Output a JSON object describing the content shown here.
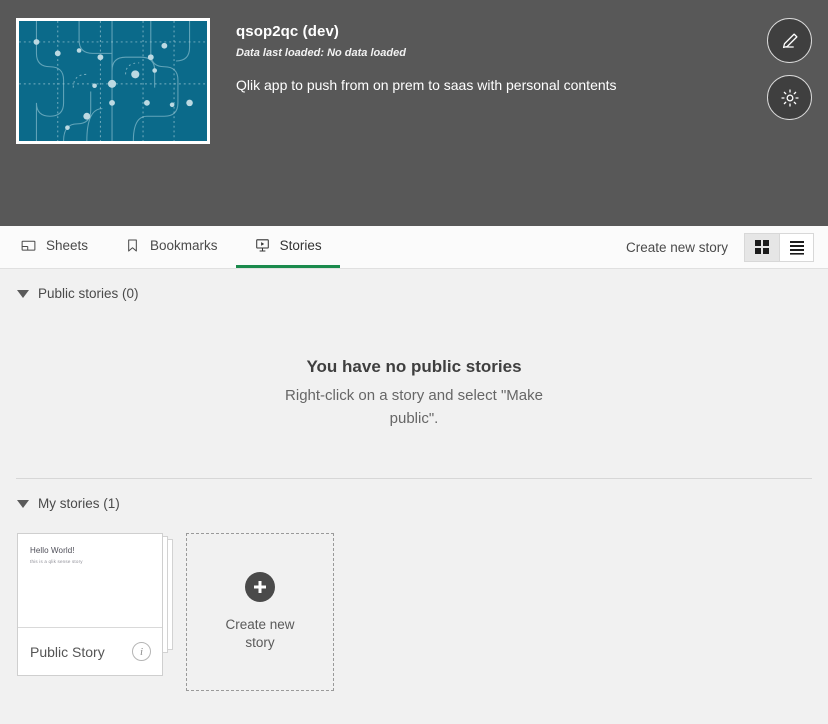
{
  "app": {
    "title": "qsop2qc (dev)",
    "data_loaded": "Data last loaded: No data loaded",
    "description": "Qlik app to push from on prem to saas with personal contents",
    "thumbnail_color": "#0b6a8a",
    "actions": [
      {
        "name": "edit",
        "icon": "pencil-icon"
      },
      {
        "name": "settings",
        "icon": "gear-icon"
      }
    ]
  },
  "tabs": [
    {
      "label": "Sheets",
      "icon": "sheet-icon",
      "active": false
    },
    {
      "label": "Bookmarks",
      "icon": "bookmark-icon",
      "active": false
    },
    {
      "label": "Stories",
      "icon": "story-icon",
      "active": true
    }
  ],
  "toolbar": {
    "create_label": "Create new story",
    "grid_view_label": "Grid view",
    "list_view_label": "List view",
    "active_view": "grid"
  },
  "sections": {
    "public": {
      "heading": "Public stories (0)",
      "empty_title": "You have no public stories",
      "empty_sub": "Right-click on a story and select \"Make public\"."
    },
    "mine": {
      "heading": "My stories (1)",
      "stories": [
        {
          "name": "Public Story",
          "thumb_title": "Hello World!",
          "thumb_sub": "this is a qlik sense story",
          "info_glyph": "i"
        }
      ],
      "create_tile": {
        "label": "Create new story",
        "icon": "plus-icon"
      }
    }
  },
  "colors": {
    "header_bg": "#585858",
    "accent_green": "#1a8a4c",
    "content_bg": "#f1f1f1"
  }
}
